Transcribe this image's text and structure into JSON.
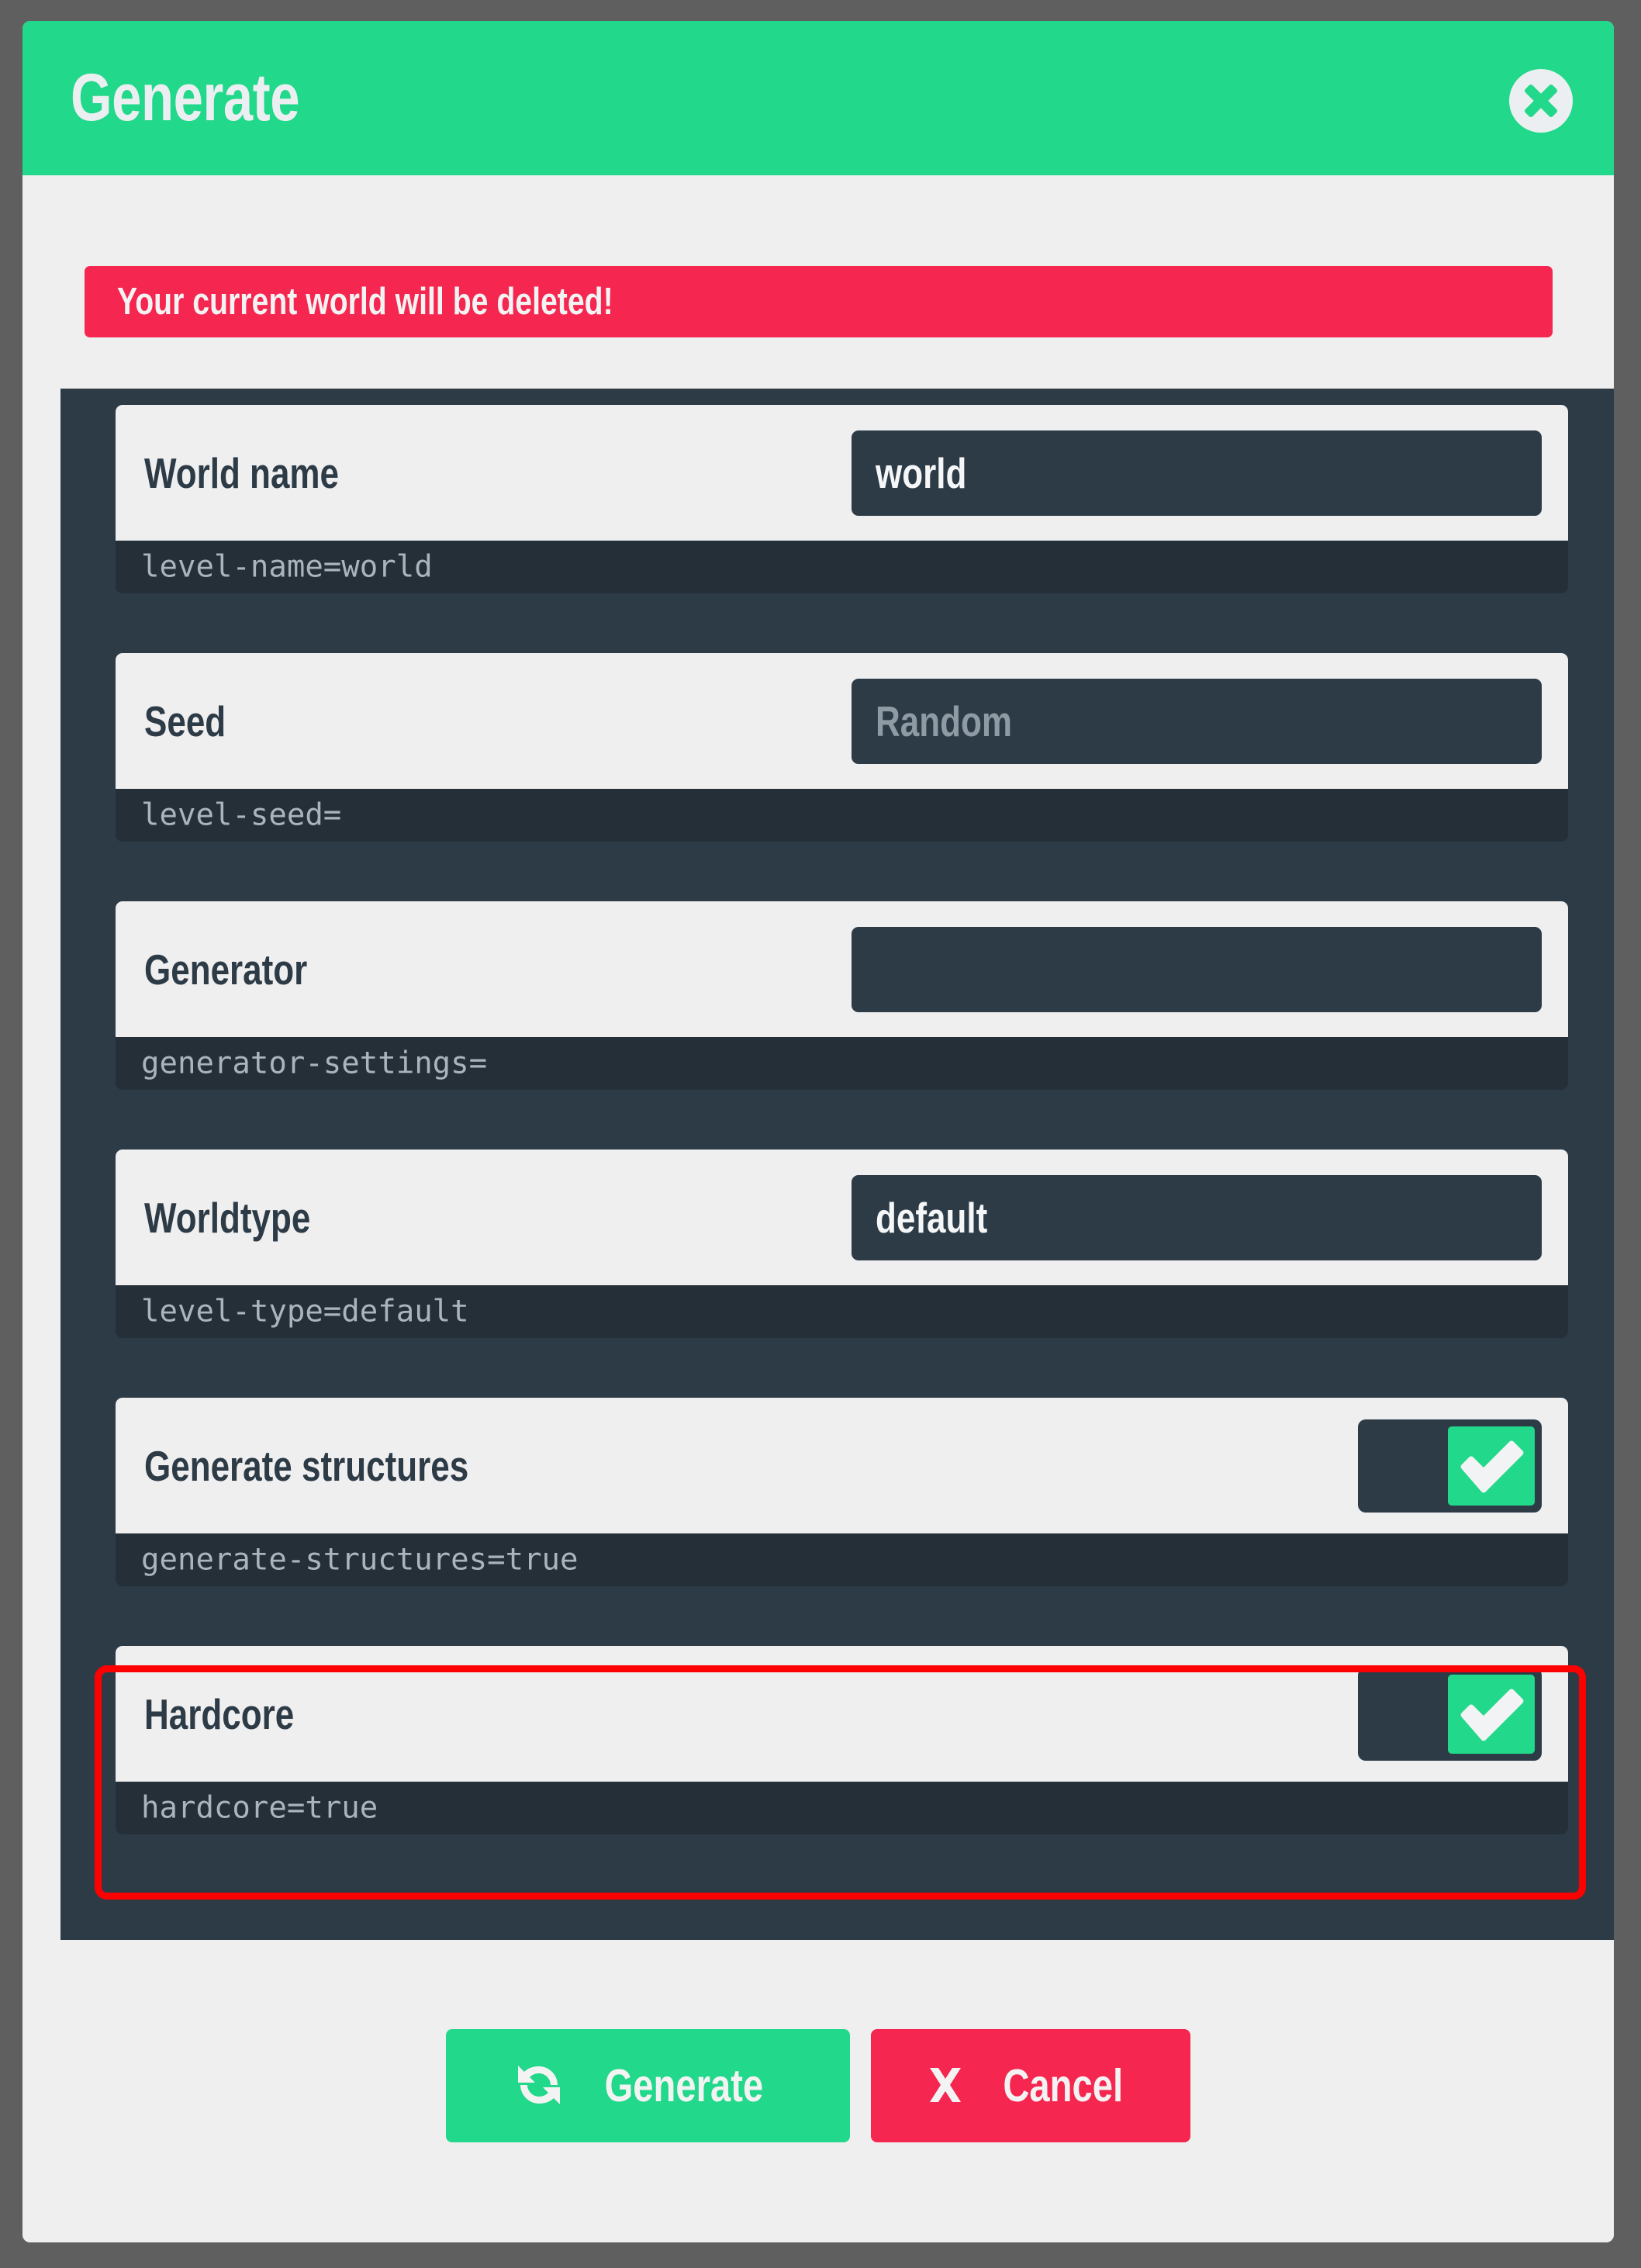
{
  "colors": {
    "backdrop": "#5f5f5f",
    "accent_green": "#22d88a",
    "danger_red": "#f5264f",
    "panel_dark": "#2d3b47",
    "code_strip": "#252f38",
    "card_light": "#efeff0",
    "highlight_outline": "#ff0000"
  },
  "header": {
    "title": "Generate",
    "close_icon": "close-icon"
  },
  "warning": {
    "message": "Your current world will be deleted!"
  },
  "options": [
    {
      "label": "World name",
      "control": "text",
      "value": "world",
      "placeholder": "",
      "is_placeholder": false,
      "code": "level-name=world",
      "highlighted": false
    },
    {
      "label": "Seed",
      "control": "text",
      "value": "Random",
      "placeholder": "Random",
      "is_placeholder": true,
      "code": "level-seed=",
      "highlighted": false
    },
    {
      "label": "Generator",
      "control": "text",
      "value": "",
      "placeholder": "",
      "is_placeholder": false,
      "code": "generator-settings=",
      "highlighted": false
    },
    {
      "label": "Worldtype",
      "control": "text",
      "value": "default",
      "placeholder": "",
      "is_placeholder": false,
      "code": "level-type=default",
      "highlighted": false
    },
    {
      "label": "Generate structures",
      "control": "toggle",
      "checked": true,
      "code": "generate-structures=true",
      "highlighted": false
    },
    {
      "label": "Hardcore",
      "control": "toggle",
      "checked": true,
      "code": "hardcore=true",
      "highlighted": true
    }
  ],
  "footer": {
    "generate_label": "Generate",
    "generate_icon": "refresh-icon",
    "cancel_label": "Cancel",
    "cancel_icon": "close-x-icon"
  }
}
